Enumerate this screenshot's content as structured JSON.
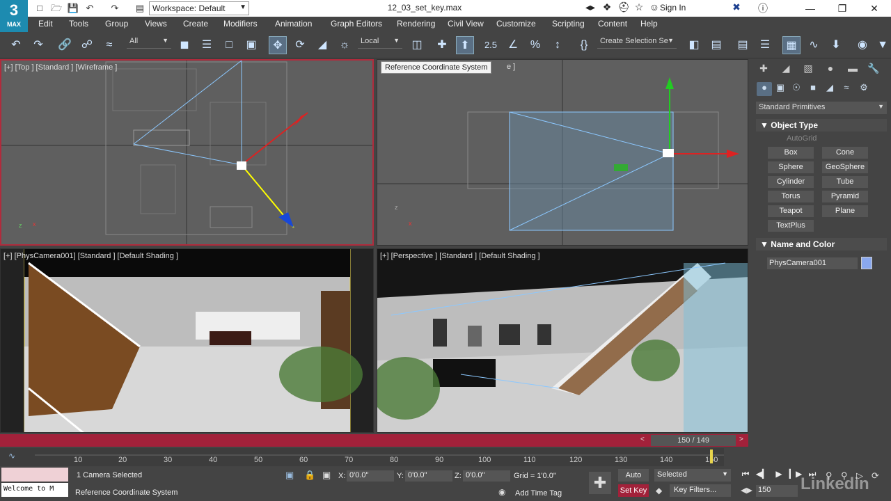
{
  "app": {
    "logo_top": "3",
    "logo_bottom": "MAX",
    "workspace_label": "Workspace: Default",
    "file_title": "12_03_set_key.max",
    "sign_in": "Sign In"
  },
  "menu": [
    "Edit",
    "Tools",
    "Group",
    "Views",
    "Create",
    "Modifiers",
    "Animation",
    "Graph Editors",
    "Rendering",
    "Civil View",
    "Customize",
    "Scripting",
    "Content",
    "Help"
  ],
  "toolbar": {
    "selection_filter": "All",
    "reference_coord": "Local",
    "create_selection_set": "Create Selection Se",
    "tooltip": "Reference Coordinate System",
    "snap_value": "2.5"
  },
  "viewports": {
    "top": "[+] [Top ] [Standard ] [Wireframe ]",
    "front_suffix": "e ]",
    "camera": "[+] [PhysCamera001] [Standard ] [Default Shading ]",
    "perspective": "[+] [Perspective ] [Standard ] [Default Shading ]"
  },
  "command_panel": {
    "category": "Standard Primitives",
    "object_type_title": "Object Type",
    "autogrid": "AutoGrid",
    "buttons": [
      "Box",
      "Cone",
      "Sphere",
      "GeoSphere",
      "Cylinder",
      "Tube",
      "Torus",
      "Pyramid",
      "Teapot",
      "Plane",
      "TextPlus"
    ],
    "name_color_title": "Name and Color",
    "object_name": "PhysCamera001",
    "object_color": "#8aa8ee"
  },
  "timeline": {
    "frame_display": "150 / 149",
    "ticks": [
      "10",
      "20",
      "30",
      "40",
      "50",
      "60",
      "70",
      "80",
      "90",
      "100",
      "110",
      "120",
      "130",
      "140",
      "150"
    ],
    "current_frame": "150"
  },
  "status": {
    "maxscript": "Welcome to M",
    "selection_info": "1 Camera Selected",
    "prompt": "Reference Coordinate System",
    "x_label": "X:",
    "x_value": "0'0.0\"",
    "y_label": "Y:",
    "y_value": "0'0.0\"",
    "z_label": "Z:",
    "z_value": "0'0.0\"",
    "grid": "Grid = 1'0.0\"",
    "add_time_tag": "Add Time Tag",
    "auto_key": "Auto Key",
    "set_key": "Set Key",
    "key_mode": "Selected",
    "key_filters": "Key Filters...",
    "watermark": "Linkedin"
  },
  "colors": {
    "accent_red": "#a2213a",
    "logo_blue": "#1d8bb0"
  }
}
